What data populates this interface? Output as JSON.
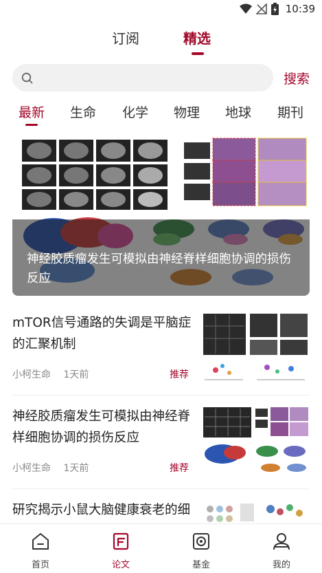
{
  "status_bar": {
    "time": "10:39"
  },
  "top_tabs": [
    {
      "label": "订阅",
      "active": false
    },
    {
      "label": "精选",
      "active": true
    }
  ],
  "search": {
    "placeholder": "",
    "button_label": "搜索"
  },
  "categories": [
    {
      "label": "最新",
      "active": true
    },
    {
      "label": "生命"
    },
    {
      "label": "化学"
    },
    {
      "label": "物理"
    },
    {
      "label": "地球"
    },
    {
      "label": "期刊"
    }
  ],
  "hero": {
    "title": "神经胶质瘤发生可模拟由神经脊样细胞协调的损伤反应"
  },
  "articles": [
    {
      "title": "mTOR信号通路的失调是平脑症的汇聚机制",
      "source": "小柯生命",
      "time": "1天前",
      "tag": "推荐"
    },
    {
      "title": "神经胶质瘤发生可模拟由神经脊样细胞协调的损伤反应",
      "source": "小柯生命",
      "time": "1天前",
      "tag": "推荐"
    },
    {
      "title": "研究揭示小鼠大脑健康衰老的细胞类型特异性转录组",
      "source": "",
      "time": "",
      "tag": ""
    }
  ],
  "bottom_nav": [
    {
      "label": "首页",
      "icon": "home-icon",
      "active": false
    },
    {
      "label": "论文",
      "icon": "paper-icon",
      "active": true
    },
    {
      "label": "基金",
      "icon": "fund-icon",
      "active": false
    },
    {
      "label": "我的",
      "icon": "user-icon",
      "active": false
    }
  ],
  "colors": {
    "accent": "#a3082a",
    "text": "#222222",
    "meta": "#888888"
  }
}
